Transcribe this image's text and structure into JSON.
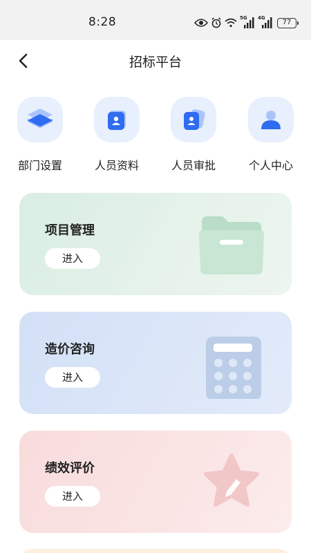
{
  "status_bar": {
    "time": "8:28",
    "battery": "77",
    "signal1_tag": "5G",
    "signal2_tag": "4G",
    "icons": [
      "eye-icon",
      "alarm-icon",
      "wifi-icon",
      "signal-icon",
      "signal-icon",
      "battery-icon"
    ]
  },
  "header": {
    "title": "招标平台",
    "back_icon": "chevron-left-icon"
  },
  "quick_actions": [
    {
      "label": "部门设置",
      "icon": "layers-icon"
    },
    {
      "label": "人员资料",
      "icon": "profile-card-icon"
    },
    {
      "label": "人员审批",
      "icon": "approval-card-icon"
    },
    {
      "label": "个人中心",
      "icon": "user-icon"
    }
  ],
  "cards": [
    {
      "title": "项目管理",
      "button": "进入",
      "icon": "folder-icon",
      "color": "#d9eee3"
    },
    {
      "title": "造价咨询",
      "button": "进入",
      "icon": "calculator-icon",
      "color": "#d3e0f6"
    },
    {
      "title": "绩效评价",
      "button": "进入",
      "icon": "star-pencil-icon",
      "color": "#f8dcdc"
    }
  ],
  "colors": {
    "accent_blue": "#2f6cf0",
    "status_bg": "#f2f2f2"
  }
}
